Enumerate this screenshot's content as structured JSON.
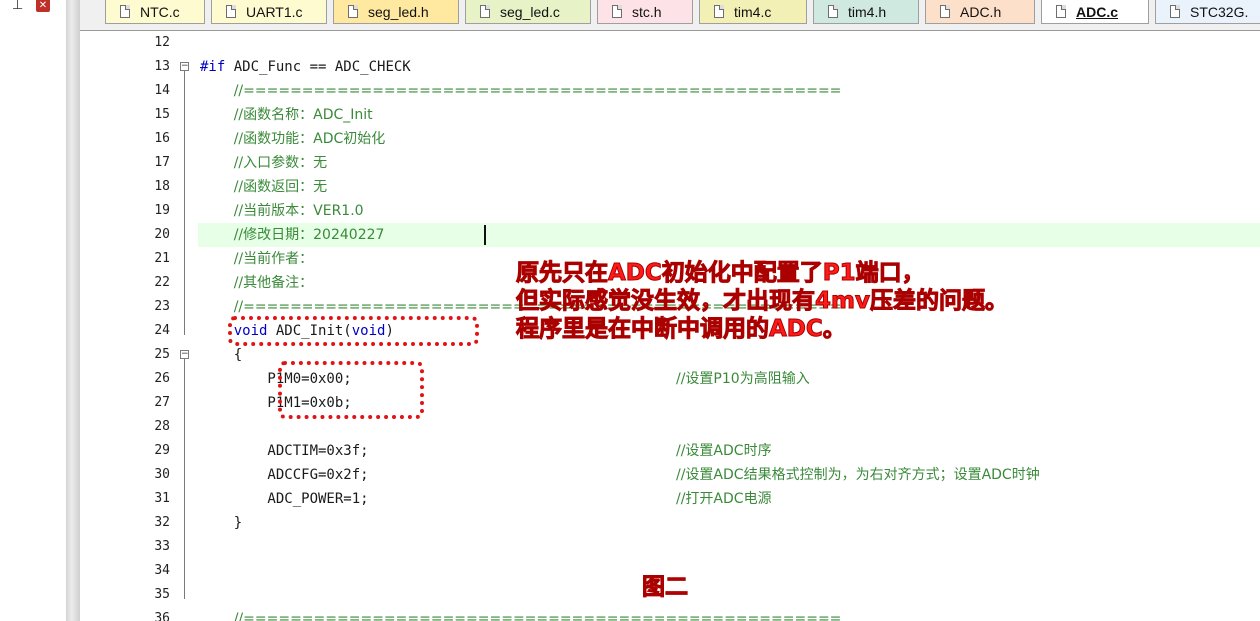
{
  "tabs": [
    {
      "label": "NTC.c",
      "color": "#fffbd0"
    },
    {
      "label": "UART1.c",
      "color": "#fffbd0"
    },
    {
      "label": "seg_led.h",
      "color": "#ffe9a0"
    },
    {
      "label": "seg_led.c",
      "color": "#e7f3c7"
    },
    {
      "label": "stc.h",
      "color": "#fde3e8"
    },
    {
      "label": "tim4.c",
      "color": "#f3f0b5"
    },
    {
      "label": "tim4.h",
      "color": "#cfe9e1"
    },
    {
      "label": "ADC.h",
      "color": "#fde0c9"
    },
    {
      "label": "ADC.c",
      "color": "#ffffff",
      "active": true
    },
    {
      "label": "STC32G.",
      "color": "#eaf3fb"
    }
  ],
  "code_lines": [
    {
      "n": "12",
      "text": ""
    },
    {
      "n": "13",
      "text": "#if ADC_Func == ADC_CHECK"
    },
    {
      "n": "14",
      "text": "    //==================================================="
    },
    {
      "n": "15",
      "text": "    //函数名称：ADC_Init"
    },
    {
      "n": "16",
      "text": "    //函数功能：ADC初始化"
    },
    {
      "n": "17",
      "text": "    //入口参数：无"
    },
    {
      "n": "18",
      "text": "    //函数返回：无"
    },
    {
      "n": "19",
      "text": "    //当前版本：VER1.0"
    },
    {
      "n": "20",
      "text": "    //修改日期：20240227"
    },
    {
      "n": "21",
      "text": "    //当前作者："
    },
    {
      "n": "22",
      "text": "    //其他备注："
    },
    {
      "n": "23",
      "text": "    //==================================================="
    },
    {
      "n": "24",
      "text": "    void ADC_Init(void)"
    },
    {
      "n": "25",
      "text": "    {"
    },
    {
      "n": "26",
      "text": "        P1M0=0x00;",
      "comment": "//设置P10为高阻输入"
    },
    {
      "n": "27",
      "text": "        P1M1=0x0b;"
    },
    {
      "n": "28",
      "text": ""
    },
    {
      "n": "29",
      "text": "        ADCTIM=0x3f;",
      "comment": "//设置ADC时序"
    },
    {
      "n": "30",
      "text": "        ADCCFG=0x2f;",
      "comment": "//设置ADC结果格式控制为，为右对齐方式；设置ADC时钟"
    },
    {
      "n": "31",
      "text": "        ADC_POWER=1;",
      "comment": "//打开ADC电源"
    },
    {
      "n": "32",
      "text": "    }"
    },
    {
      "n": "33",
      "text": ""
    },
    {
      "n": "34",
      "text": ""
    },
    {
      "n": "35",
      "text": ""
    },
    {
      "n": "36",
      "text": "    //==================================================="
    }
  ],
  "annotation": {
    "line1": "原先只在ADC初始化中配置了P1端口，",
    "line2": "但实际感觉没生效，才出现有4mv压差的问题。",
    "line3": "程序里是在中断中调用的ADC。",
    "figure_label": "图二",
    "color": "#ff1a1a"
  },
  "icons": {
    "pin": "pin-icon",
    "close": "close-icon",
    "file": "file-icon"
  }
}
